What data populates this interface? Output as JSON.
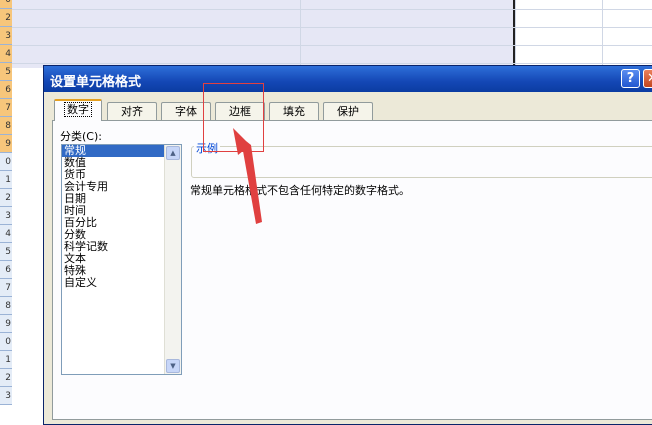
{
  "row_numbers": [
    "0",
    "2",
    "3",
    "4",
    "5",
    "6",
    "7",
    "8",
    "9",
    "0",
    "1",
    "2",
    "3",
    "4",
    "5",
    "6",
    "7",
    "8",
    "9",
    "0",
    "1",
    "2",
    "3"
  ],
  "dialog": {
    "title": "设置单元格格式",
    "help_label": "?",
    "close_label": "✕",
    "tabs": [
      {
        "label": "数字",
        "active": true
      },
      {
        "label": "对齐",
        "active": false
      },
      {
        "label": "字体",
        "active": false
      },
      {
        "label": "边框",
        "active": false
      },
      {
        "label": "填充",
        "active": false
      },
      {
        "label": "保护",
        "active": false
      }
    ],
    "category": {
      "label": "分类(C):",
      "selected": "常规",
      "items": [
        "常规",
        "数值",
        "货币",
        "会计专用",
        "日期",
        "时间",
        "百分比",
        "分数",
        "科学记数",
        "文本",
        "特殊",
        "自定义"
      ]
    },
    "sample_label": "示例",
    "description": "常规单元格格式不包含任何特定的数字格式。"
  },
  "annotation": {
    "color": "#e04040"
  }
}
